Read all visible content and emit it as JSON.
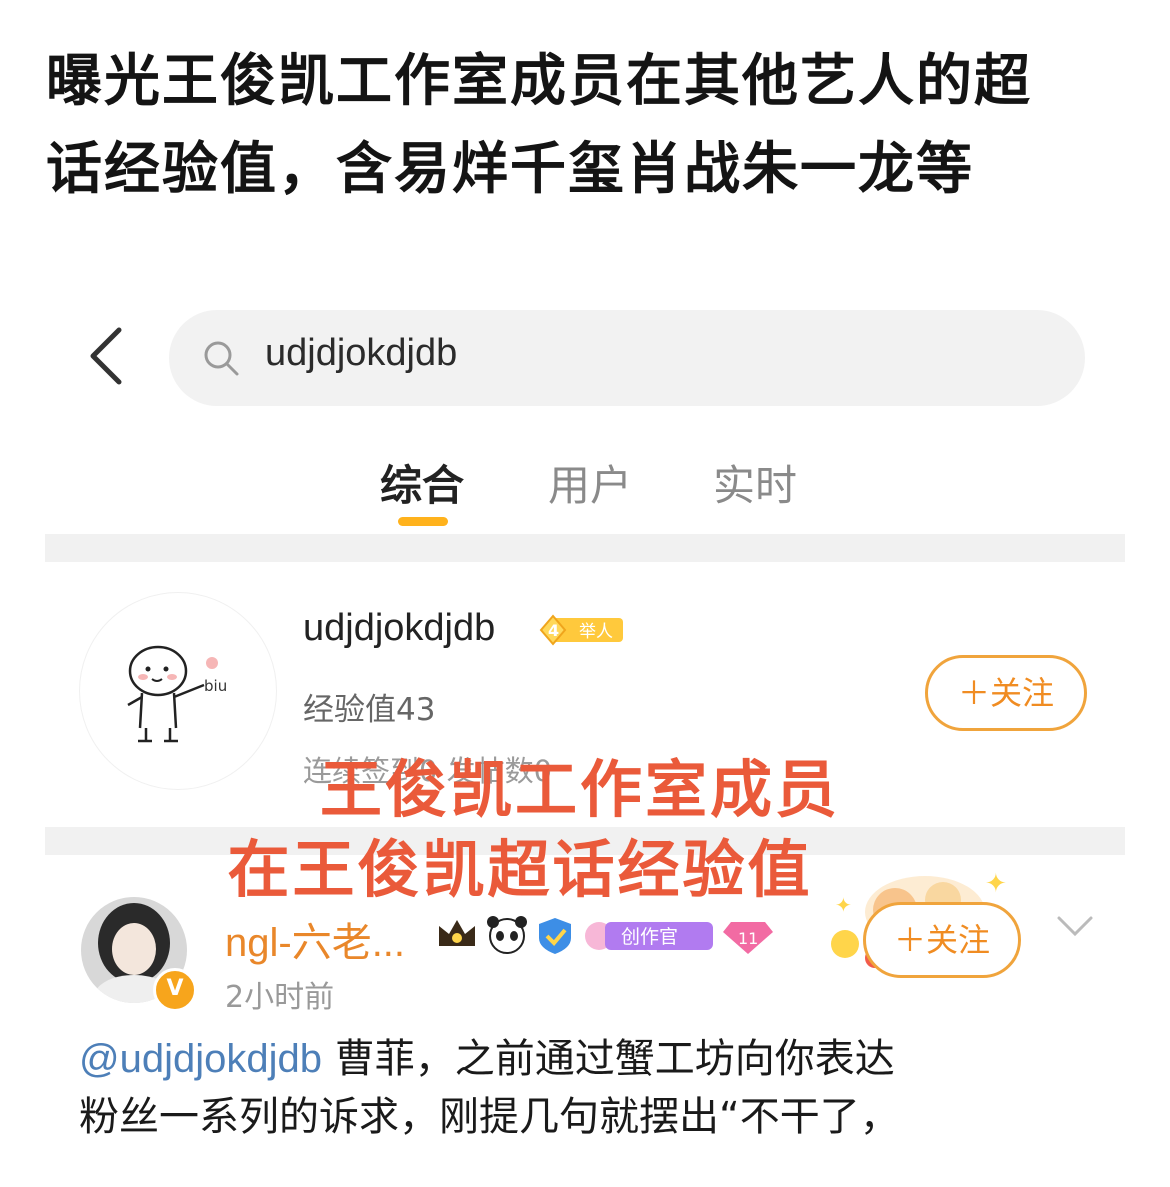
{
  "headline": {
    "line1": "曝光王俊凯工作室成员在其他艺人的超",
    "line2": "话经验值，含易烊千玺肖战朱一龙等"
  },
  "search": {
    "query": "udjdjokdjdb"
  },
  "tabs": [
    {
      "label": "综合",
      "active": true
    },
    {
      "label": "用户",
      "active": false
    },
    {
      "label": "实时",
      "active": false
    }
  ],
  "user_card": {
    "username": "udjdjokdjdb",
    "level": "4",
    "level_title": "举人",
    "experience": "经验值43",
    "stats": "连续签到0 发帖数0",
    "follow_label": "＋关注"
  },
  "overlay": {
    "line1": "王俊凯工作室成员",
    "line2": "在王俊凯超话经验值"
  },
  "post": {
    "author": "ngl-六老...",
    "creator_badge": "创作官",
    "time": "2小时前",
    "follow_label": "＋关注",
    "mention": "@udjdjokdjdb",
    "text_line1": " 曹菲，之前通过蟹工坊向你表达",
    "text_line2": "粉丝一系列的诉求，刚提几句就摆出“不干了，"
  },
  "colors": {
    "accent": "#ffb21c",
    "follow_orange": "#f08c22",
    "overlay_red": "#ea5a3a",
    "mention_blue": "#4d7fb8"
  }
}
